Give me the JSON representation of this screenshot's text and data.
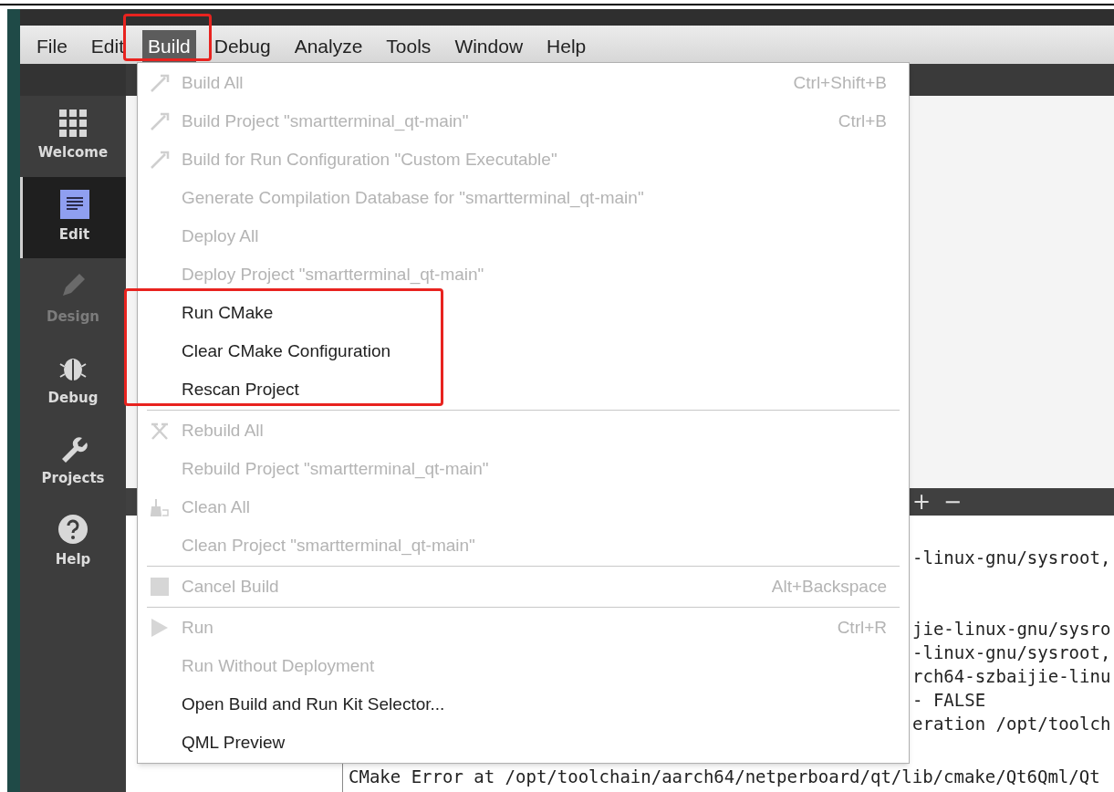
{
  "menubar": [
    {
      "label": "File",
      "selected": false
    },
    {
      "label": "Edit",
      "selected": false
    },
    {
      "label": "Build",
      "selected": true
    },
    {
      "label": "Debug",
      "selected": false
    },
    {
      "label": "Analyze",
      "selected": false
    },
    {
      "label": "Tools",
      "selected": false
    },
    {
      "label": "Window",
      "selected": false
    },
    {
      "label": "Help",
      "selected": false
    }
  ],
  "sidebar": [
    {
      "kind": "welcome",
      "label": "Welcome",
      "selected": false,
      "disabled": false
    },
    {
      "kind": "edit",
      "label": "Edit",
      "selected": true,
      "disabled": false
    },
    {
      "kind": "design",
      "label": "Design",
      "selected": false,
      "disabled": true
    },
    {
      "kind": "debug",
      "label": "Debug",
      "selected": false,
      "disabled": false
    },
    {
      "kind": "projects",
      "label": "Projects",
      "selected": false,
      "disabled": false
    },
    {
      "kind": "help",
      "label": "Help",
      "selected": false,
      "disabled": false
    }
  ],
  "output": {
    "header": [
      "+",
      "−"
    ],
    "fragments": [
      [
        "-linux-gnu/sysroot,"
      ],
      [
        "jie-linux-gnu/sysro",
        "-linux-gnu/sysroot,",
        "rch64-szbaijie-linu",
        "- FALSE",
        "eration /opt/toolch"
      ]
    ],
    "lines": [
      "CMake Error at /opt/toolchain/aarch64/netperboard/qt/lib/cmake/Qt6Qml/Qt"
    ]
  },
  "menu": [
    {
      "kind": "build",
      "label": "Build All",
      "shortcut": "Ctrl+Shift+B",
      "disabled": true
    },
    {
      "kind": "build",
      "label": "Build Project \"smartterminal_qt-main\"",
      "shortcut": "Ctrl+B",
      "disabled": true
    },
    {
      "kind": "build",
      "label": "Build for Run Configuration \"Custom Executable\"",
      "disabled": true
    },
    {
      "kind": "plain",
      "label": "Generate Compilation Database for \"smartterminal_qt-main\"",
      "disabled": true
    },
    {
      "kind": "plain",
      "label": "Deploy All",
      "disabled": true
    },
    {
      "kind": "plain",
      "label": "Deploy Project \"smartterminal_qt-main\"",
      "disabled": true
    },
    {
      "kind": "plain",
      "label": "Run CMake",
      "disabled": false
    },
    {
      "kind": "plain",
      "label": "Clear CMake Configuration",
      "disabled": false
    },
    {
      "kind": "plain",
      "label": "Rescan Project",
      "disabled": false
    },
    {
      "kind": "separator"
    },
    {
      "kind": "rebuild",
      "label": "Rebuild All",
      "disabled": true
    },
    {
      "kind": "plain",
      "label": "Rebuild Project \"smartterminal_qt-main\"",
      "disabled": true
    },
    {
      "kind": "clean",
      "label": "Clean All",
      "disabled": true
    },
    {
      "kind": "plain",
      "label": "Clean Project \"smartterminal_qt-main\"",
      "disabled": true
    },
    {
      "kind": "separator"
    },
    {
      "kind": "cancel",
      "label": "Cancel Build",
      "shortcut": "Alt+Backspace",
      "disabled": true
    },
    {
      "kind": "separator"
    },
    {
      "kind": "run",
      "label": "Run",
      "shortcut": "Ctrl+R",
      "disabled": true
    },
    {
      "kind": "plain",
      "label": "Run Without Deployment",
      "disabled": true
    },
    {
      "kind": "plain",
      "label": "Open Build and Run Kit Selector...",
      "disabled": false
    },
    {
      "kind": "plain",
      "label": "QML Preview",
      "disabled": false
    }
  ]
}
